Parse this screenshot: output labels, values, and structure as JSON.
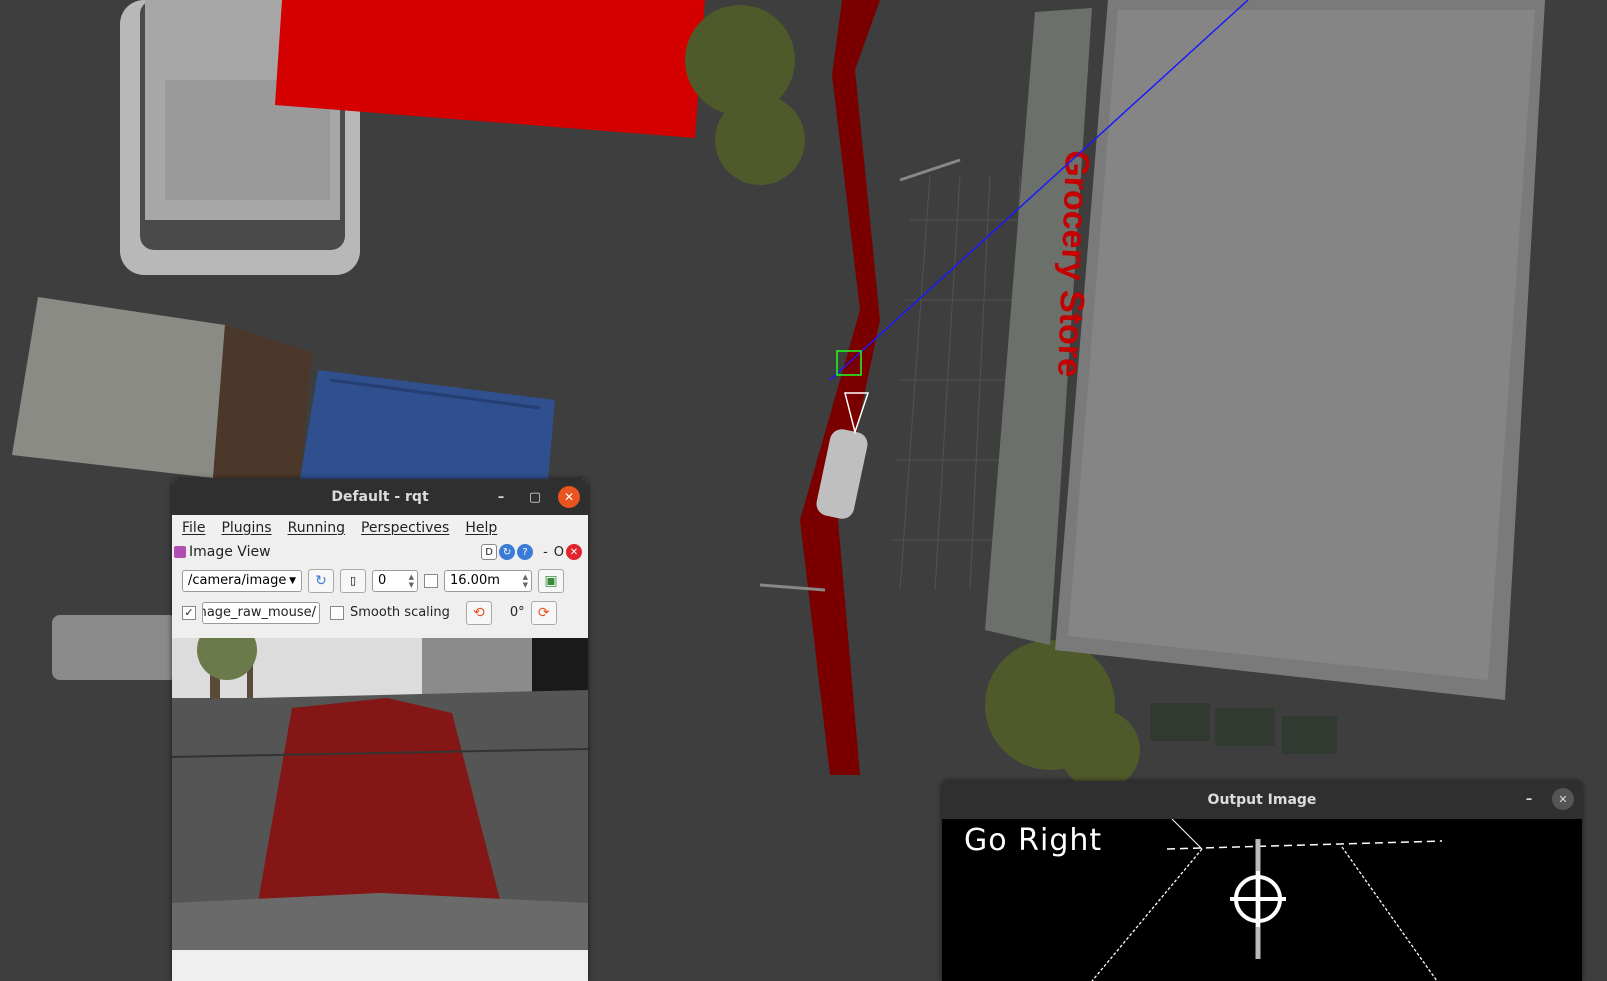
{
  "rqt_window": {
    "title": "Default - rqt",
    "menu": [
      "File",
      "Plugins",
      "Running",
      "Perspectives",
      "Help"
    ],
    "plugin_title": "Image View",
    "plugin_controls": {
      "d_label": "D",
      "dash_label": "-",
      "o_label": "O"
    },
    "topic_combo": "/camera/image",
    "zoom_value": "0",
    "distance_value": "16.00m",
    "publish_checked": true,
    "publish_topic": "/camera/image_raw_mouse",
    "smooth_scaling_label": "Smooth scaling",
    "smooth_scaling_checked": false,
    "rotation_label": "0°"
  },
  "output_window": {
    "title": "Output Image",
    "status_text": "Go Right"
  },
  "scene": {
    "store_sign": "Grocery Store",
    "colors": {
      "lane": "#7a0000",
      "ground": "#3d3d3d",
      "red_block": "#d40000",
      "accent": "#e95420"
    }
  }
}
